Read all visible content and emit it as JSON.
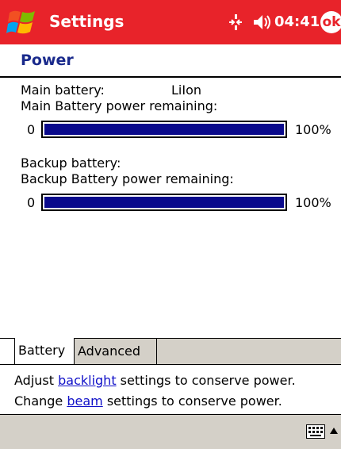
{
  "titlebar": {
    "title": "Settings",
    "clock": "04:41",
    "ok_label": "ok",
    "start_icon": "windows-flag-icon",
    "connectivity_icon": "connectivity-icon",
    "volume_icon": "speaker-icon",
    "bg_color": "#e8232a"
  },
  "page": {
    "title": "Power"
  },
  "main_battery": {
    "type_label": "Main battery:",
    "type_value": "LiIon",
    "remaining_label": "Main Battery power remaining:",
    "min_label": "0",
    "percent": 100,
    "percent_label": "100%"
  },
  "backup_battery": {
    "type_label": "Backup battery:",
    "remaining_label": "Backup Battery power remaining:",
    "min_label": "0",
    "percent": 100,
    "percent_label": "100%"
  },
  "tabs": [
    {
      "label": "Battery",
      "active": true
    },
    {
      "label": "Advanced",
      "active": false
    }
  ],
  "links": {
    "backlight": {
      "prefix": "Adjust ",
      "link": "backlight",
      "suffix": " settings to conserve power."
    },
    "beam": {
      "prefix": "Change ",
      "link": "beam",
      "suffix": " settings to conserve power."
    }
  },
  "menubar": {
    "keyboard_icon": "keyboard-icon",
    "arrow_icon": "up-arrow-icon"
  },
  "colors": {
    "bar_fill": "#0a0a8c",
    "link": "#1010c8",
    "heading": "#1a2a8c"
  }
}
